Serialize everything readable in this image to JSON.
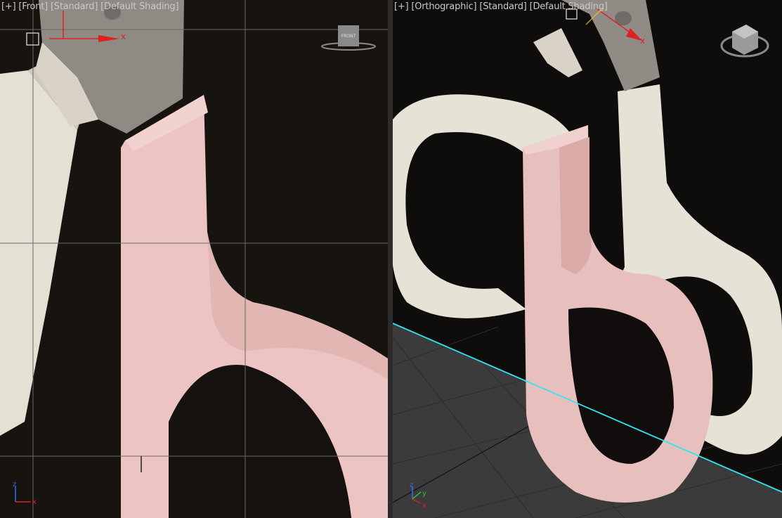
{
  "left_viewport": {
    "menu_plus": "[+]",
    "view_name": "[Front]",
    "render_mode": "[Standard]",
    "shading_mode": "[Default Shading]",
    "viewcube_face": "FRONT",
    "gizmo_axis_x": "x",
    "axis_tripod": {
      "z": "z",
      "x": "x"
    }
  },
  "right_viewport": {
    "menu_plus": "[+]",
    "view_name": "[Orthographic]",
    "render_mode": "[Standard]",
    "shading_mode": "[Default Shading]",
    "gizmo_axis_x": "x",
    "axis_tripod": {
      "z": "z",
      "y": "y",
      "x": "x"
    }
  },
  "colors": {
    "model_pink": "#e8c1be",
    "handle_white": "#e6e2d6",
    "blade_metal": "#8f8a84",
    "background_photo": "#14110f",
    "grid_floor": "#3a3a3a",
    "cyan_axis": "#2fe6f0",
    "gizmo_red": "#e02020"
  }
}
